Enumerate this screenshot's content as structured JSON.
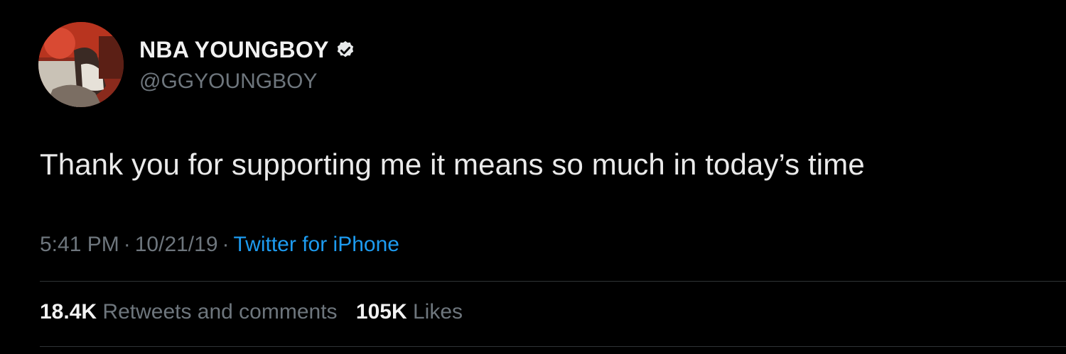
{
  "tweet": {
    "author": {
      "display_name": "NBA YOUNGBOY",
      "handle": "@GGYOUNGBOY",
      "verified": true,
      "avatar_icon": "profile-photo"
    },
    "text": "Thank you for supporting me it means so much in today’s time",
    "meta": {
      "time": "5:41 PM",
      "separator": "·",
      "date": "10/21/19",
      "source": "Twitter for iPhone"
    },
    "stats": {
      "retweets_count": "18.4K",
      "retweets_label": "Retweets and comments",
      "likes_count": "105K",
      "likes_label": "Likes"
    }
  },
  "colors": {
    "background": "#000000",
    "primary_text": "#e7e9ea",
    "secondary_text": "#6e767d",
    "link": "#1d9bf0",
    "verified_badge": "#e7e9ea",
    "divider": "#2f3336"
  }
}
